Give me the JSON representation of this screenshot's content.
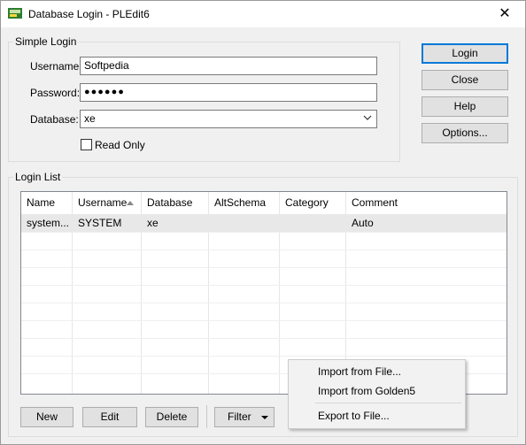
{
  "window": {
    "title": "Database Login - PLEdit6",
    "close_glyph": "✕"
  },
  "simple_login": {
    "group_label": "Simple Login",
    "username_label": "Username:",
    "username_value": "Softpedia",
    "password_label": "Password:",
    "password_value": "●●●●●●",
    "database_label": "Database:",
    "database_value": "xe",
    "read_only_label": "Read Only",
    "read_only_checked": false
  },
  "side_buttons": {
    "login": "Login",
    "close": "Close",
    "help": "Help",
    "options": "Options..."
  },
  "login_list": {
    "group_label": "Login List",
    "columns": [
      "Name",
      "Username",
      "Database",
      "AltSchema",
      "Category",
      "Comment"
    ],
    "sorted_column": "Username",
    "rows": [
      {
        "name": "system...",
        "username": "SYSTEM",
        "database": "xe",
        "altschema": "",
        "category": "",
        "comment": "Auto"
      }
    ]
  },
  "bottom_buttons": {
    "new": "New",
    "edit": "Edit",
    "delete": "Delete",
    "filter": "Filter"
  },
  "filter_menu": {
    "items": [
      "Import from File...",
      "Import from Golden5",
      "Export to File..."
    ]
  },
  "colors": {
    "accent": "#0078d7",
    "window_bg": "#f0f0f0",
    "selected_row": "#e8e8e8"
  }
}
